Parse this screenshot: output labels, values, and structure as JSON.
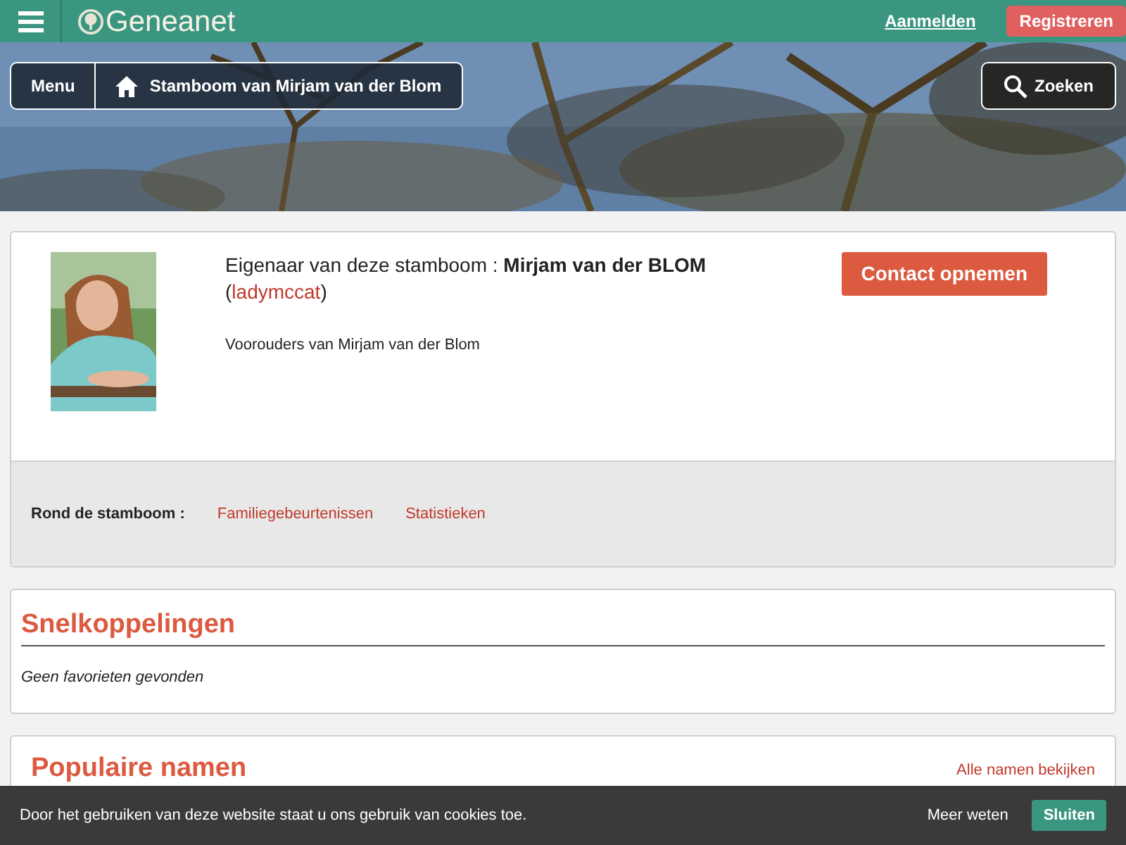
{
  "header": {
    "logo": "Geneanet",
    "login": "Aanmelden",
    "register": "Registreren"
  },
  "hero": {
    "menu": "Menu",
    "breadcrumb": "Stamboom van Mirjam van der Blom",
    "search": "Zoeken"
  },
  "owner": {
    "label": "Eigenaar van deze stamboom : **Mirjam van der BLOM**",
    "paren_open": "(",
    "username": "ladymccat",
    "paren_close": ")",
    "description": "Voorouders van Mirjam van der Blom",
    "contact": "Contact opnemen",
    "around_label": "Rond de stamboom :",
    "around_links": [
      "Familiegebeurtenissen",
      "Statistieken"
    ]
  },
  "shortcuts": {
    "title": "Snelkoppelingen",
    "empty": "Geen favorieten gevonden"
  },
  "popular": {
    "title": "Populaire namen",
    "all_link": "Alle namen bekijken"
  },
  "cookie": {
    "text": "Door het gebruiken van deze website staat u ons gebruik van cookies toe.",
    "more": "Meer weten",
    "close": "Sluiten"
  }
}
